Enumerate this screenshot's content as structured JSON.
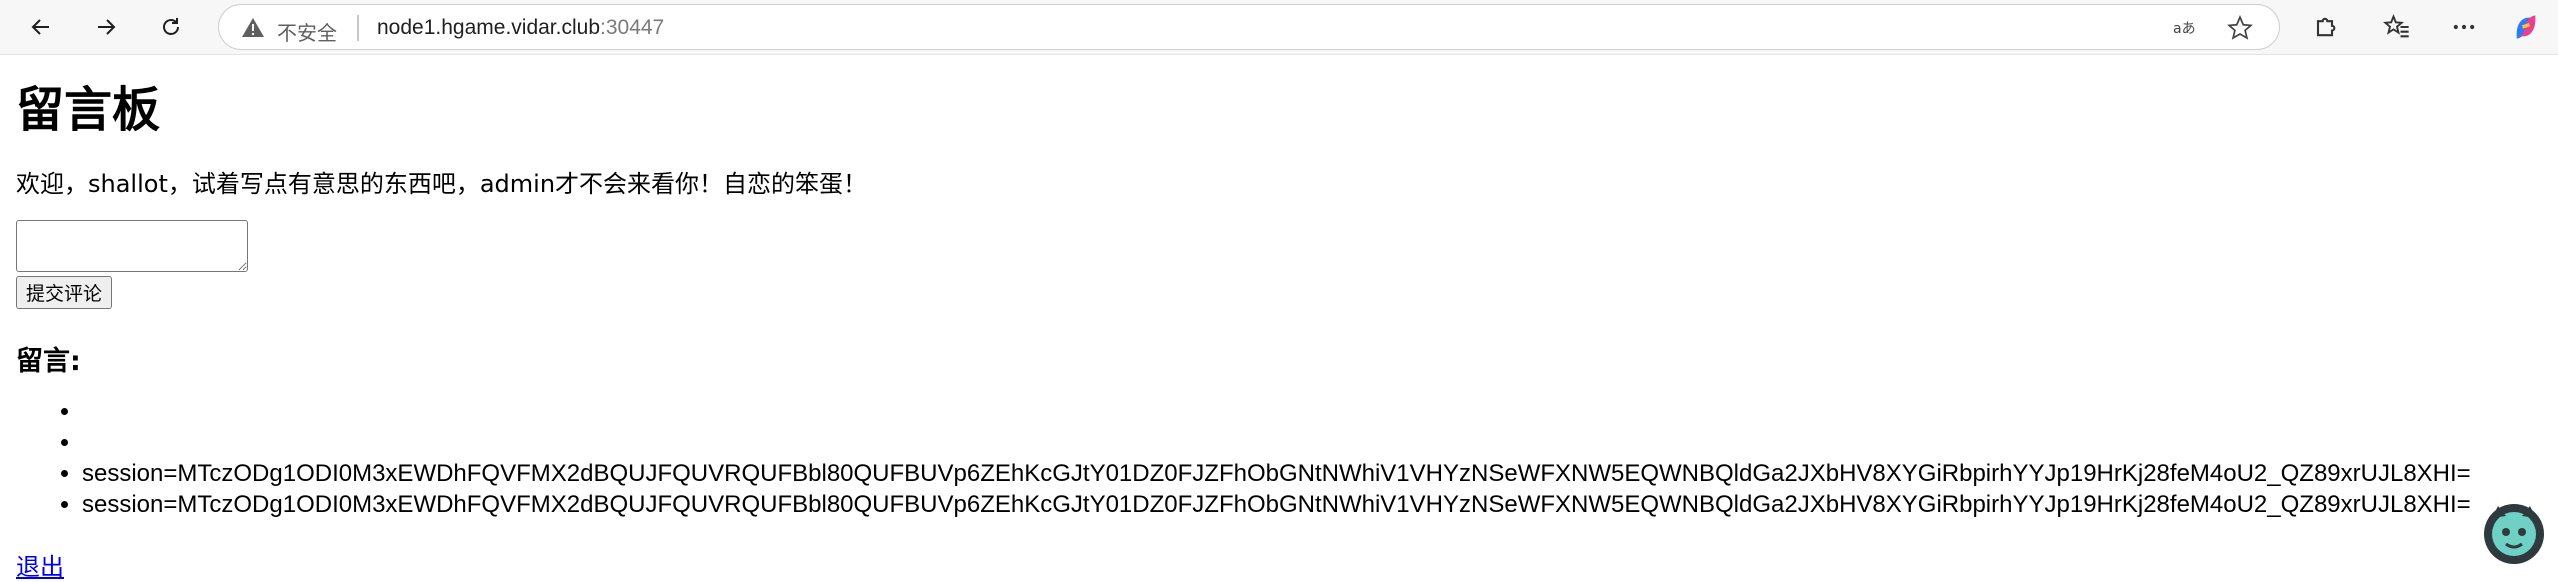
{
  "browser": {
    "back_icon": "arrow-left-icon",
    "forward_icon": "arrow-right-icon",
    "refresh_icon": "refresh-icon",
    "security_label": "不安全",
    "url_host": "node1.hgame.vidar.club",
    "url_port": ":30447",
    "read_aloud_icon": "read-aloud-icon",
    "favorite_icon": "star-icon",
    "extensions_icon": "puzzle-icon",
    "favorites_icon": "favorites-list-icon",
    "more_icon": "ellipsis-icon",
    "copilot_icon": "copilot-icon"
  },
  "page": {
    "title": "留言板",
    "welcome": "欢迎，shallot，试着写点有意思的东西吧，admin才不会来看你！自恋的笨蛋！",
    "comment_input": {
      "value": "",
      "placeholder": ""
    },
    "submit_label": "提交评论",
    "comments_heading": "留言:",
    "comments": [
      "",
      "",
      "session=MTczODg1ODI0M3xEWDhFQVFMX2dBQUJFQUVRQUFBbl80QUFBUVp6ZEhKcGJtY01DZ0FJZFhObGNtNWhiV1VHYzNSeWFXNW5EQWNBQldGa2JXbHV8XYGiRbpirhYYJp19HrKj28feM4oU2_QZ89xrUJL8XHI=",
      "session=MTczODg1ODI0M3xEWDhFQVFMX2dBQUJFQUVRQUFBbl80QUFBUVp6ZEhKcGJtY01DZ0FJZFhObGNtNWhiV1VHYzNSeWFXNW5EQWNBQldGa2JXbHV8XYGiRbpirhYYJp19HrKj28feM4oU2_QZ89xrUJL8XHI="
    ],
    "logout_label": "退出"
  }
}
